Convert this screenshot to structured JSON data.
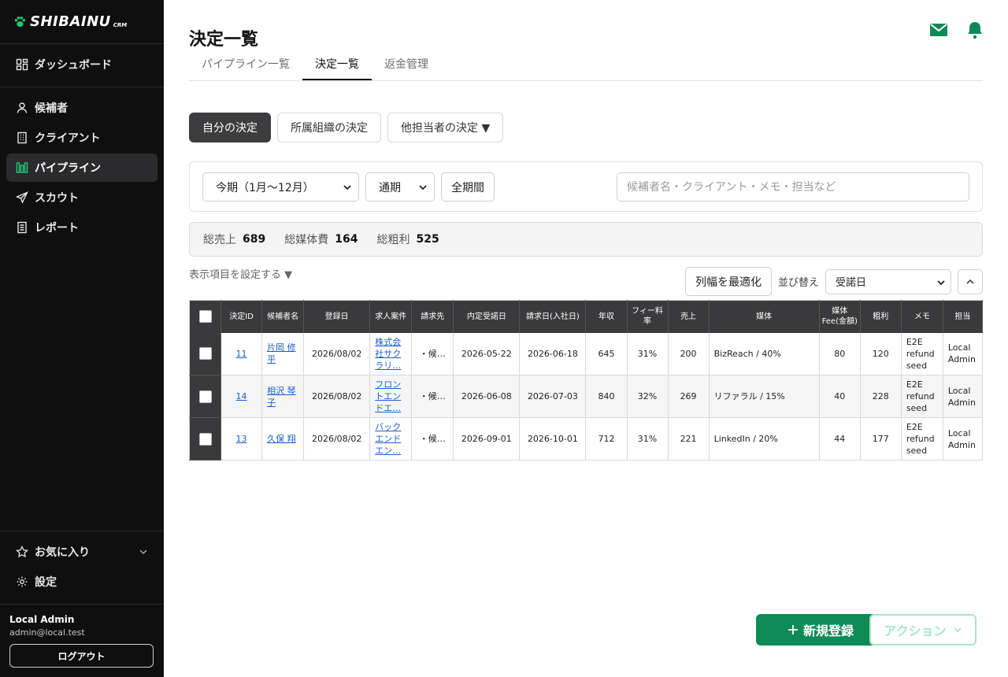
{
  "brand": {
    "name": "SHIBAINU",
    "sub": "CRM"
  },
  "nav": {
    "dashboard": "ダッシュボード",
    "candidates": "候補者",
    "clients": "クライアント",
    "pipeline": "パイプライン",
    "scout": "スカウト",
    "report": "レポート",
    "favorites": "お気に入り",
    "settings": "設定"
  },
  "user": {
    "name": "Local Admin",
    "email": "admin@local.test",
    "logout": "ログアウト"
  },
  "page": {
    "title": "決定一覧"
  },
  "tabs": [
    {
      "label": "パイプライン一覧"
    },
    {
      "label": "決定一覧"
    },
    {
      "label": "返金管理"
    }
  ],
  "scope": {
    "mine": "自分の決定",
    "org": "所属組織の決定",
    "others": "他担当者の決定 ▼"
  },
  "filters": {
    "period": "今期（1月〜12月）",
    "term": "通期",
    "all_period": "全期間",
    "search_placeholder": "候補者名・クライアント・メモ・担当など"
  },
  "summary": {
    "sales_label": "総売上",
    "sales": "689",
    "media_label": "総媒体費",
    "media": "164",
    "profit_label": "総粗利",
    "profit": "525"
  },
  "tools": {
    "col_config": "表示項目を設定する ▼",
    "fit_columns": "列幅を最適化",
    "sort_label": "並び替え",
    "sort_value": "受諾日"
  },
  "table": {
    "headers": {
      "id": "決定ID",
      "candidate": "候補者名",
      "registered": "登録日",
      "job": "求人案件",
      "billing": "請求先",
      "offer_date": "内定受諾日",
      "start_date": "請求日(入社日)",
      "salary": "年収",
      "fee_rate": "フィー料率",
      "sales": "売上",
      "media": "媒体",
      "media_fee": "媒体Fee(金額)",
      "profit": "粗利",
      "memo": "メモ",
      "owner": "担当"
    },
    "rows": [
      {
        "id": "11",
        "candidate": "片岡 修平",
        "registered": "2026/08/02",
        "job": "株式会社サクラリ…",
        "billing": "・候…",
        "offer_date": "2026-05-22",
        "start_date": "2026-06-18",
        "salary": "645",
        "fee_rate": "31%",
        "sales": "200",
        "media": "BizReach / 40%",
        "media_fee": "80",
        "profit": "120",
        "memo": "E2E refund seed",
        "owner": "Local Admin"
      },
      {
        "id": "14",
        "candidate": "相沢 琴子",
        "registered": "2026/08/02",
        "job": "フロントエンドエ…",
        "billing": "・候…",
        "offer_date": "2026-06-08",
        "start_date": "2026-07-03",
        "salary": "840",
        "fee_rate": "32%",
        "sales": "269",
        "media": "リファラル / 15%",
        "media_fee": "40",
        "profit": "228",
        "memo": "E2E refund seed",
        "owner": "Local Admin"
      },
      {
        "id": "13",
        "candidate": "久保 翔",
        "registered": "2026/08/02",
        "job": "バックエンドエン…",
        "billing": "・候…",
        "offer_date": "2026-09-01",
        "start_date": "2026-10-01",
        "salary": "712",
        "fee_rate": "31%",
        "sales": "221",
        "media": "LinkedIn / 20%",
        "media_fee": "44",
        "profit": "177",
        "memo": "E2E refund seed",
        "owner": "Local Admin"
      }
    ]
  },
  "actions": {
    "new": "新規登録",
    "action": "アクション"
  },
  "colors": {
    "accent": "#0e8a57",
    "sidebar": "#0f0f10",
    "header_bg": "#3a3a3c",
    "link": "#1a5fc9"
  }
}
